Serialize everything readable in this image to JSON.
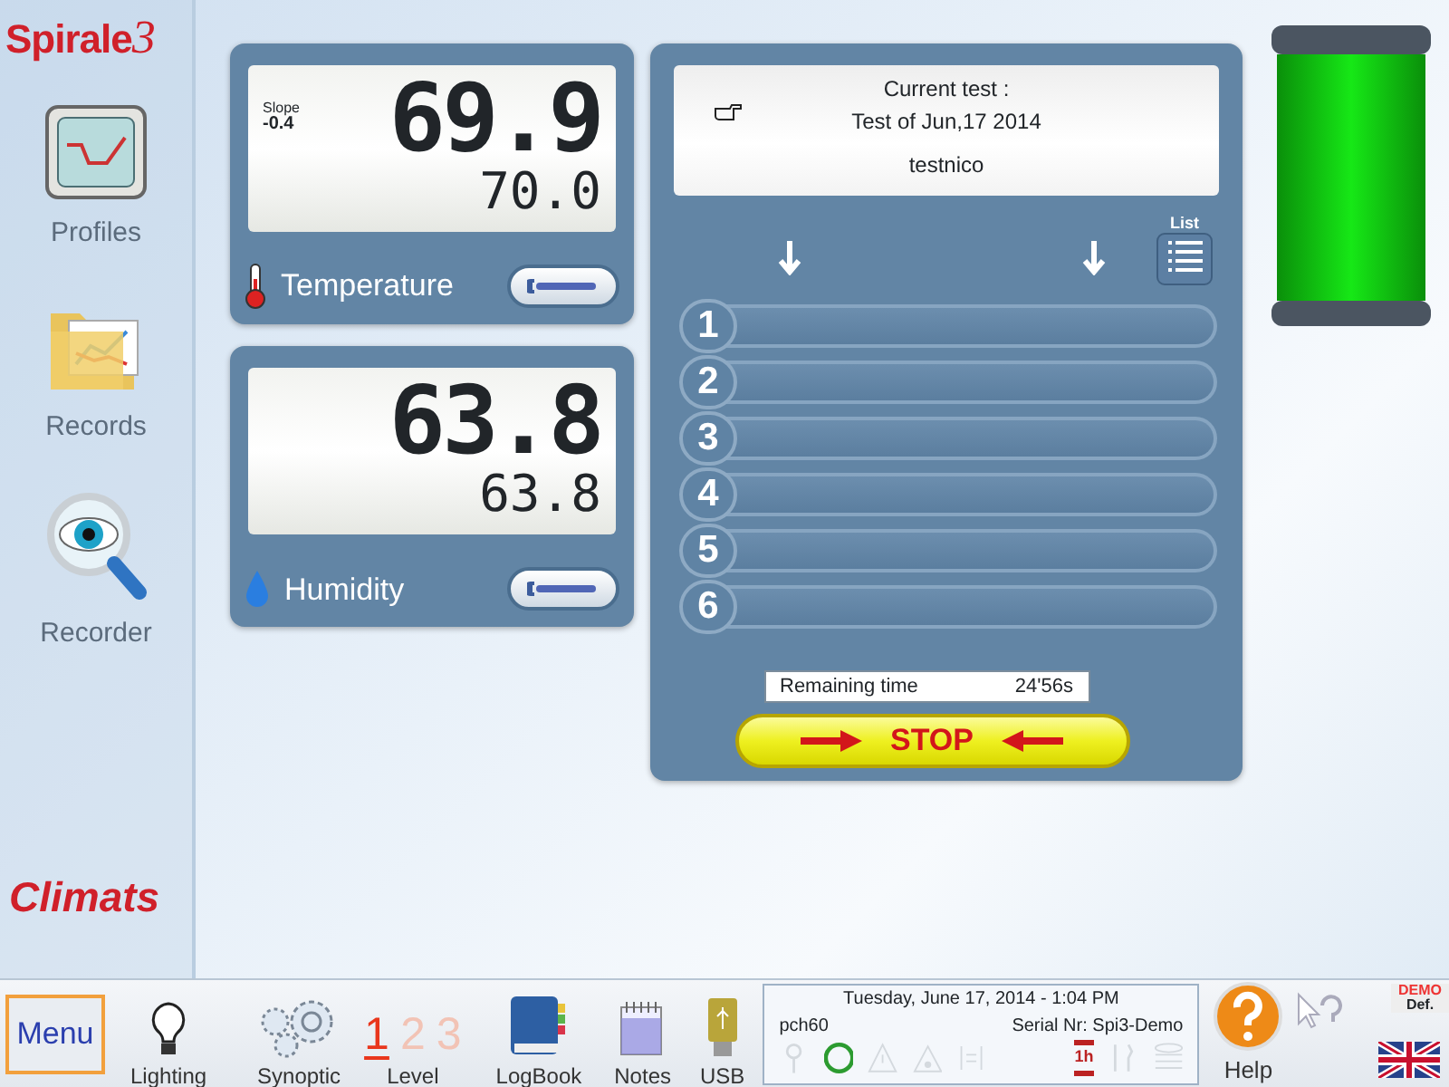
{
  "app": {
    "logo": "Spirale",
    "logo_number": "3",
    "brand": "Climats"
  },
  "sidebar": {
    "items": [
      {
        "kind": "profiles",
        "label": "Profiles"
      },
      {
        "kind": "records",
        "label": "Records"
      },
      {
        "kind": "recorder",
        "label": "Recorder"
      }
    ]
  },
  "sensors": [
    {
      "kind": "temperature",
      "label": "Temperature",
      "slope_label": "Slope",
      "slope": "-0.4",
      "measured": "69.9",
      "setpoint": "70.0"
    },
    {
      "kind": "humidity",
      "label": "Humidity",
      "measured": "63.8",
      "setpoint": "63.8"
    }
  ],
  "test": {
    "title": "Current test :",
    "name": "Test of Jun,17 2014",
    "user": "testnico",
    "list_label": "List",
    "steps": [
      {
        "number": "1"
      },
      {
        "number": "2"
      },
      {
        "number": "3"
      },
      {
        "number": "4"
      },
      {
        "number": "5"
      },
      {
        "number": "6"
      }
    ],
    "remaining_label": "Remaining time",
    "remaining": "24'56s",
    "stop_label": "STOP"
  },
  "toolbar": {
    "menu": "Menu",
    "items": [
      {
        "kind": "lighting",
        "label": "Lighting"
      },
      {
        "kind": "synoptic",
        "label": "Synoptic"
      },
      {
        "kind": "level",
        "label": "Level",
        "levels": [
          {
            "label": "1",
            "selected": true
          },
          {
            "label": "2",
            "selected": false
          },
          {
            "label": "3",
            "selected": false
          }
        ]
      },
      {
        "kind": "logbook",
        "label": "LogBook"
      },
      {
        "kind": "notes",
        "label": "Notes"
      },
      {
        "kind": "usb",
        "label": "USB"
      }
    ]
  },
  "status_bar": {
    "datetime": "Tuesday, June 17, 2014 - 1:04 PM",
    "user": "pch60",
    "serial": "Serial Nr: Spi3-Demo",
    "icons": [
      {
        "kind": "key",
        "active": false
      },
      {
        "kind": "ring",
        "active": true
      },
      {
        "kind": "warning",
        "active": false
      },
      {
        "kind": "drop",
        "active": false
      },
      {
        "kind": "list",
        "active": false
      },
      {
        "kind": "timer",
        "active": true,
        "label": "1h"
      },
      {
        "kind": "tools",
        "active": false
      },
      {
        "kind": "stack",
        "active": false
      }
    ]
  },
  "help": {
    "label": "Help"
  },
  "mode": {
    "badge": "DEMO",
    "default": "Def."
  }
}
